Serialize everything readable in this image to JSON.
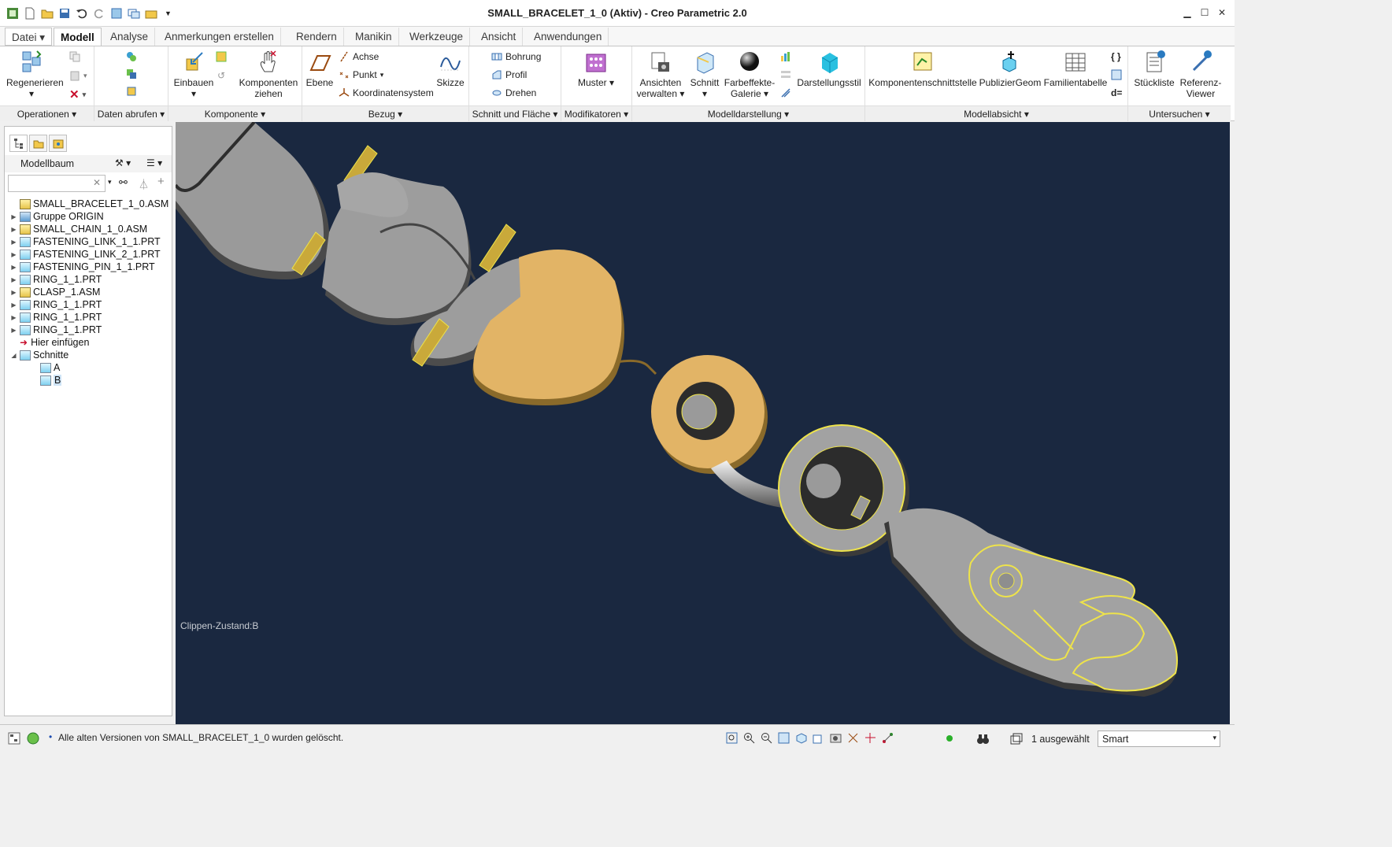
{
  "window": {
    "title": "SMALL_BRACELET_1_0 (Aktiv) - Creo Parametric 2.0"
  },
  "tabs": [
    "Datei",
    "Modell",
    "Analyse",
    "Anmerkungen erstellen",
    "Rendern",
    "Manikin",
    "Werkzeuge",
    "Ansicht",
    "Anwendungen"
  ],
  "ribbon": {
    "regen": "Regenerieren",
    "einbauen": "Einbauen",
    "komp_ziehen_1": "Komponenten",
    "komp_ziehen_2": "ziehen",
    "ebene": "Ebene",
    "achse": "Achse",
    "punkt": "Punkt",
    "koord": "Koordinatensystem",
    "skizze": "Skizze",
    "bohrung": "Bohrung",
    "profil": "Profil",
    "drehen": "Drehen",
    "muster": "Muster",
    "ansichten_1": "Ansichten",
    "ansichten_2": "verwalten",
    "schnitt": "Schnitt",
    "farbe_1": "Farbeffekte-",
    "farbe_2": "Galerie",
    "darstellungsstil": "Darstellungsstil",
    "kompschnitt": "Komponentenschnittstelle",
    "publizier": "PublizierGeom",
    "familie": "Familientabelle",
    "stueckliste": "Stückliste",
    "referenz_1": "Referenz-",
    "referenz_2": "Viewer",
    "groups": {
      "operationen": "Operationen",
      "daten": "Daten abrufen",
      "komponente": "Komponente",
      "bezug": "Bezug",
      "schnitt": "Schnitt und Fläche",
      "modifikatoren": "Modifikatoren",
      "modelldarstellung": "Modelldarstellung",
      "modellabsicht": "Modellabsicht",
      "untersuchen": "Untersuchen"
    }
  },
  "panel": {
    "title": "Modellbaum"
  },
  "tree": [
    {
      "label": "SMALL_BRACELET_1_0.ASM",
      "type": "asm",
      "level": 0
    },
    {
      "label": "Gruppe ORIGIN",
      "type": "grp",
      "level": 1
    },
    {
      "label": "SMALL_CHAIN_1_0.ASM",
      "type": "asm",
      "level": 1
    },
    {
      "label": "FASTENING_LINK_1_1.PRT",
      "type": "prt",
      "level": 1
    },
    {
      "label": "FASTENING_LINK_2_1.PRT",
      "type": "prt",
      "level": 1
    },
    {
      "label": "FASTENING_PIN_1_1.PRT",
      "type": "prt",
      "level": 1
    },
    {
      "label": "RING_1_1.PRT",
      "type": "prt",
      "level": 1
    },
    {
      "label": "CLASP_1.ASM",
      "type": "asm",
      "level": 1
    },
    {
      "label": "RING_1_1.PRT",
      "type": "prt",
      "level": 1
    },
    {
      "label": "RING_1_1.PRT",
      "type": "prt",
      "level": 1
    },
    {
      "label": "RING_1_1.PRT",
      "type": "prt",
      "level": 1
    },
    {
      "label": "Hier einfügen",
      "type": "insert",
      "level": 1
    },
    {
      "label": "Schnitte",
      "type": "folder",
      "level": 1
    },
    {
      "label": "A",
      "type": "xsec",
      "level": 2
    },
    {
      "label": "B",
      "type": "xsec",
      "level": 2
    }
  ],
  "viewport": {
    "clip_state": "Clippen-Zustand:B"
  },
  "status": {
    "message": "Alle alten Versionen von SMALL_BRACELET_1_0 wurden gelöscht.",
    "selected": "1 ausgewählt",
    "filter": "Smart"
  }
}
